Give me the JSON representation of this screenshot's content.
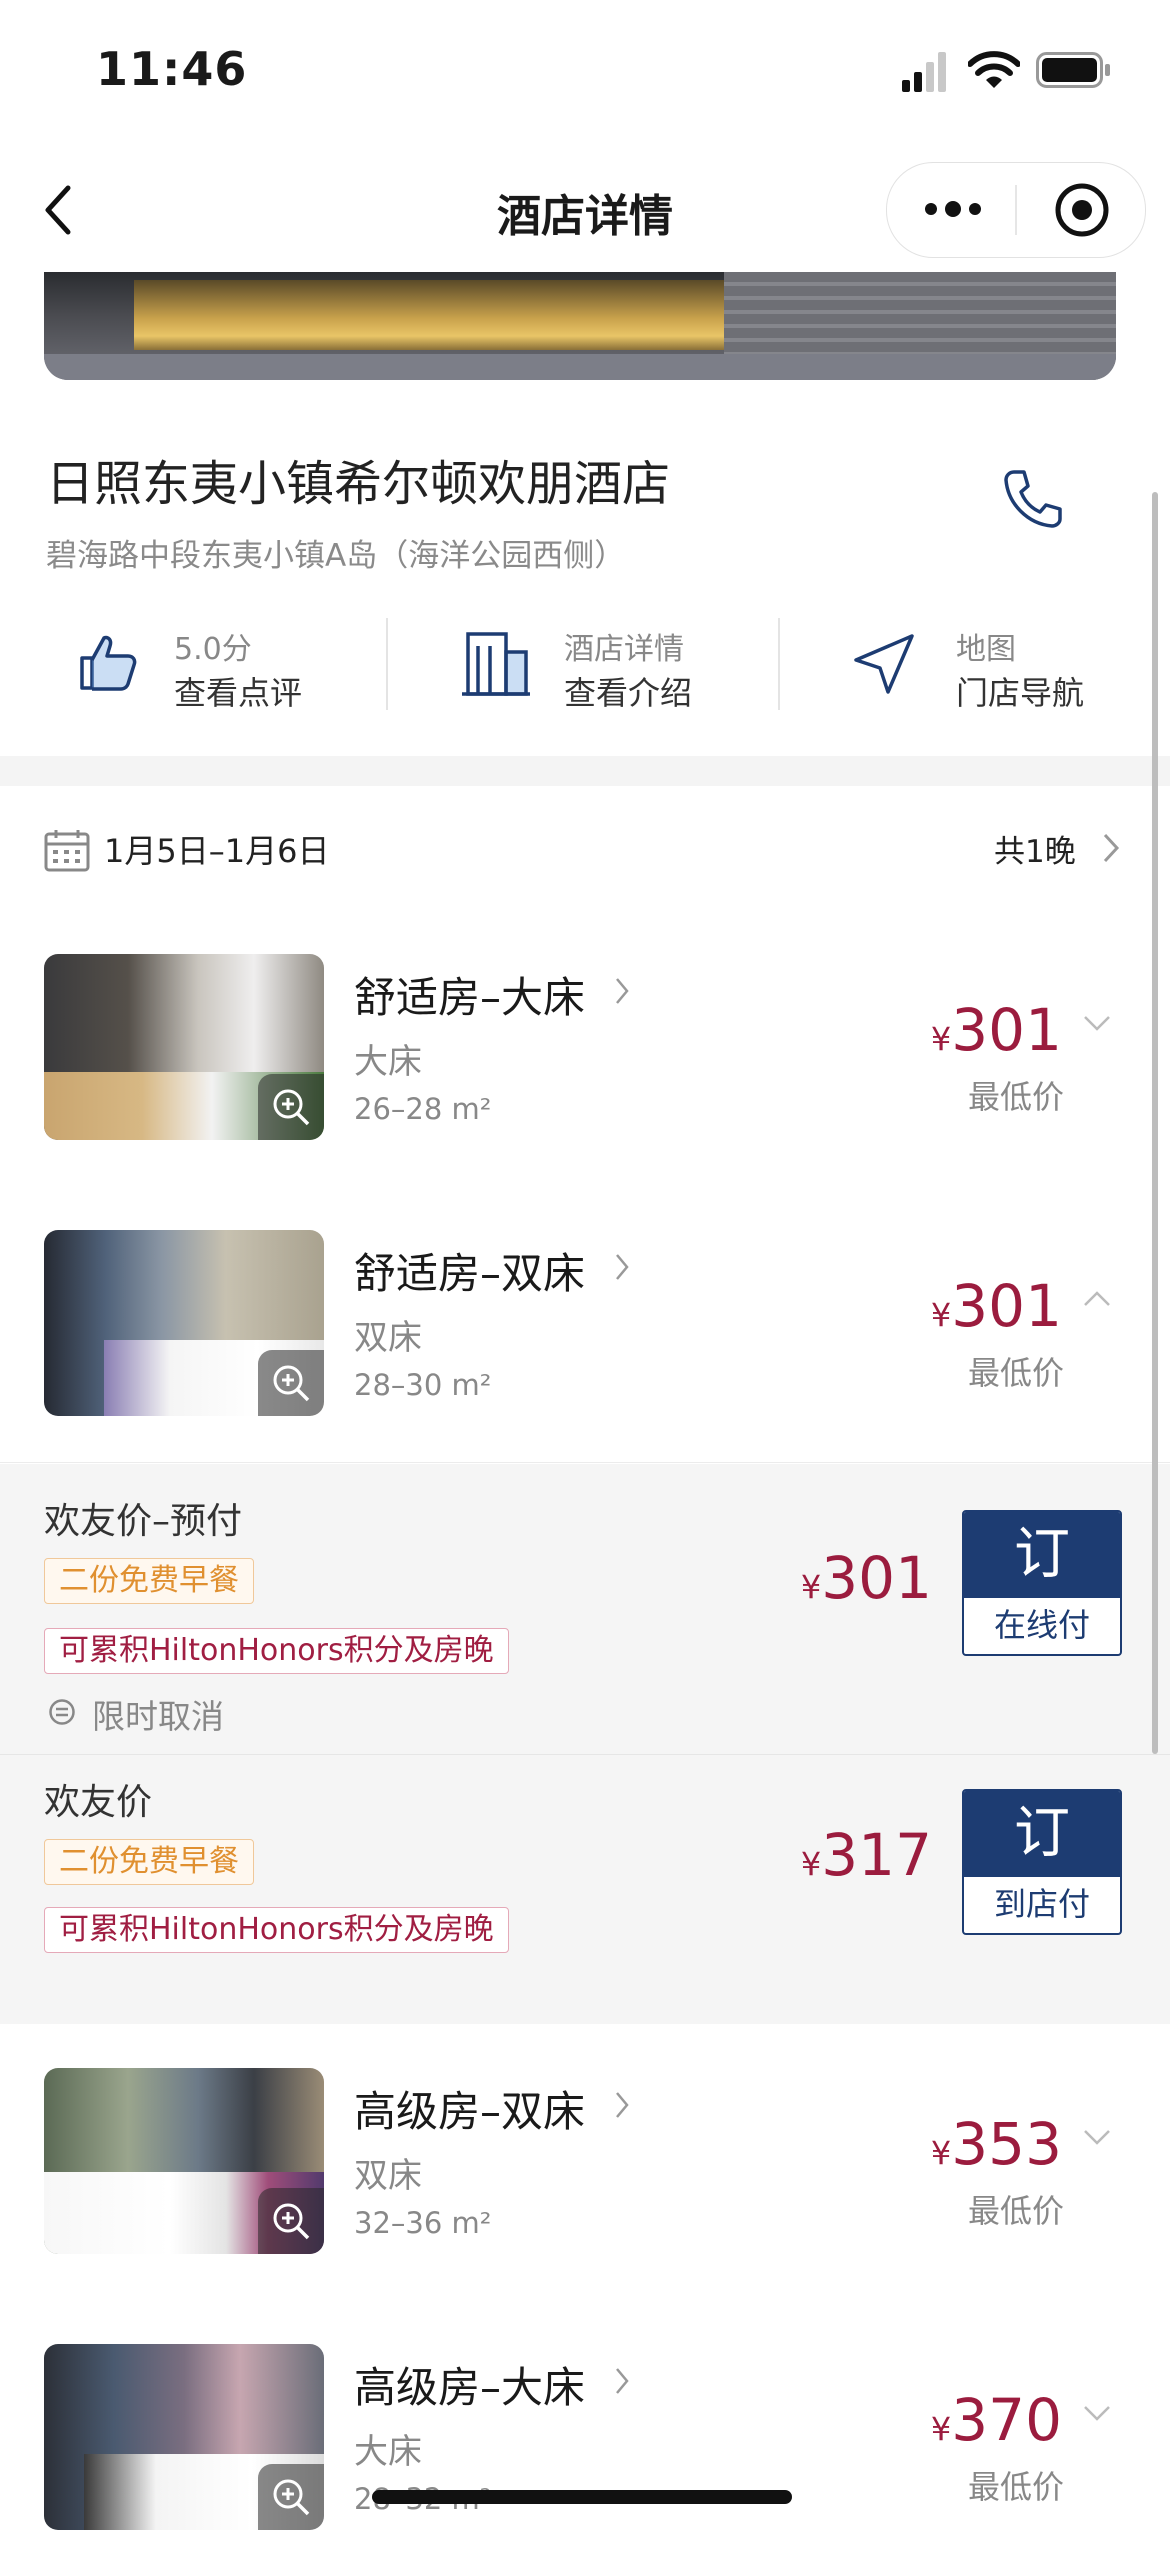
{
  "status_bar": {
    "time": "11:46"
  },
  "nav": {
    "title": "酒店详情"
  },
  "hotel": {
    "name": "日照东夷小镇希尔顿欢朋酒店",
    "address": "碧海路中段东夷小镇A岛（海洋公园西侧）"
  },
  "actions": [
    {
      "line1": "5.0分",
      "line2": "查看点评",
      "icon": "thumbs-up-icon"
    },
    {
      "line1": "酒店详情",
      "line2": "查看介绍",
      "icon": "building-icon"
    },
    {
      "line1": "地图",
      "line2": "门店导航",
      "icon": "navigation-arrow-icon"
    }
  ],
  "stay": {
    "dates": "1月5日–1月6日",
    "nights": "共1晚"
  },
  "currency": "¥",
  "rooms": [
    {
      "name": "舒适房–大床",
      "bed": "大床",
      "size": "26–28 m²",
      "price": "301",
      "price_label": "最低价",
      "expanded": false
    },
    {
      "name": "舒适房–双床",
      "bed": "双床",
      "size": "28–30 m²",
      "price": "301",
      "price_label": "最低价",
      "expanded": true
    },
    {
      "name": "高级房–双床",
      "bed": "双床",
      "size": "32–36 m²",
      "price": "353",
      "price_label": "最低价",
      "expanded": false
    },
    {
      "name": "高级房–大床",
      "bed": "大床",
      "size": "28–32 m²",
      "price": "370",
      "price_label": "最低价",
      "expanded": false
    }
  ],
  "rate_plans": [
    {
      "title": "欢友价–预付",
      "tag_breakfast": "二份免费早餐",
      "tag_honors": "可累积HiltonHonors积分及房晚",
      "cancel": "限时取消",
      "price": "301",
      "book_label": "订",
      "pay_label": "在线付"
    },
    {
      "title": "欢友价",
      "tag_breakfast": "二份免费早餐",
      "tag_honors": "可累积HiltonHonors积分及房晚",
      "price": "317",
      "book_label": "订",
      "pay_label": "到店付"
    }
  ],
  "colors": {
    "price": "#9b1c3e",
    "book_button": "#1d3c72",
    "tag_orange": "#e09030",
    "tag_red": "#a01e42"
  }
}
